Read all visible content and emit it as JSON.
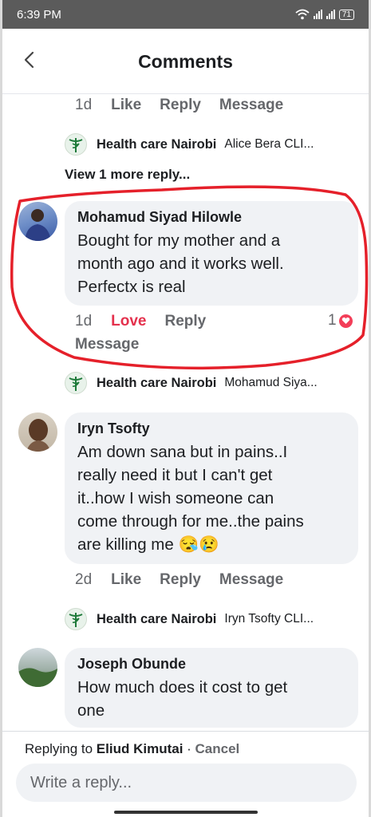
{
  "status_bar": {
    "time": "6:39 PM",
    "battery": "71"
  },
  "header": {
    "title": "Comments"
  },
  "top_actions": {
    "age": "1d",
    "like": "Like",
    "reply": "Reply",
    "message": "Message"
  },
  "page_reply_1": {
    "name": "Health care Nairobi",
    "text": "Alice Bera CLI..."
  },
  "view_more": "View 1 more reply...",
  "comment_1": {
    "author": "Mohamud Siyad Hilowle",
    "lines": [
      "Bought for my mother and a",
      "month ago and it works well.",
      "Perfectx is real"
    ],
    "age": "1d",
    "love": "Love",
    "reply": "Reply",
    "message": "Message",
    "reaction_count": "1"
  },
  "page_reply_2": {
    "name": "Health care Nairobi",
    "text": "Mohamud Siya..."
  },
  "comment_2": {
    "author": "Iryn Tsofty",
    "lines": [
      "Am down sana but in pains..I",
      "really need it but I can't get",
      "it..how I wish someone can",
      "come through for me..the pains",
      "are killing me 😪😢"
    ],
    "age": "2d",
    "like": "Like",
    "reply": "Reply",
    "message": "Message"
  },
  "page_reply_3": {
    "name": "Health care Nairobi",
    "text": "Iryn Tsofty CLI..."
  },
  "comment_3": {
    "author": "Joseph Obunde",
    "lines": [
      "How much does it cost to get",
      "one"
    ]
  },
  "reply_bar": {
    "prefix": "Replying to",
    "target": "Eliud Kimutai",
    "separator": " · ",
    "cancel": "Cancel",
    "placeholder": "Write a reply..."
  },
  "icons": [
    "back-arrow-icon",
    "wifi-icon",
    "signal-icon",
    "battery-icon",
    "caduceus-logo-icon",
    "heart-reaction-icon"
  ],
  "colors": {
    "love": "#e4314d",
    "annotation": "#e5202a",
    "bubble": "#f0f2f5"
  }
}
